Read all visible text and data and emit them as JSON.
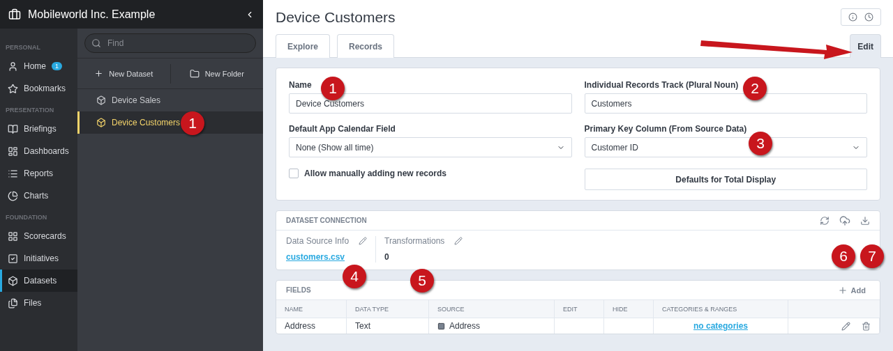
{
  "org": {
    "title": "Mobileworld Inc. Example"
  },
  "nav": [
    {
      "heading": "PERSONAL",
      "items": [
        {
          "label": "Home",
          "badge": "1",
          "selected": false
        },
        {
          "label": "Bookmarks",
          "selected": false
        }
      ]
    },
    {
      "heading": "PRESENTATION",
      "items": [
        {
          "label": "Briefings",
          "selected": false
        },
        {
          "label": "Dashboards",
          "selected": false
        },
        {
          "label": "Reports",
          "selected": false
        },
        {
          "label": "Charts",
          "selected": false
        }
      ]
    },
    {
      "heading": "FOUNDATION",
      "items": [
        {
          "label": "Scorecards",
          "selected": false
        },
        {
          "label": "Initiatives",
          "selected": false
        },
        {
          "label": "Datasets",
          "selected": true
        },
        {
          "label": "Files",
          "selected": false
        }
      ]
    }
  ],
  "browser": {
    "search_placeholder": "Find",
    "actions": [
      "New Dataset",
      "New Folder"
    ],
    "items": [
      {
        "label": "Device Sales",
        "selected": false
      },
      {
        "label": "Device Customers",
        "selected": true
      }
    ]
  },
  "page": {
    "title": "Device Customers",
    "tabs": [
      {
        "label": "Explore",
        "selected": false
      },
      {
        "label": "Records",
        "selected": false
      },
      {
        "label": "Edit",
        "selected": true
      }
    ]
  },
  "settings": {
    "name_label": "Name",
    "name_value": "Device Customers",
    "records_label": "Individual Records Track (Plural Noun)",
    "records_value": "Customers",
    "calendar_label": "Default App Calendar Field",
    "calendar_value": "None (Show all time)",
    "key_label": "Primary Key Column (From Source Data)",
    "key_value": "Customer ID",
    "allow_label": "Allow manually adding new records",
    "allow_checked": false,
    "defaults_button": "Defaults for Total Display"
  },
  "connection": {
    "title": "DATASET CONNECTION",
    "source_label": "Data Source Info",
    "source_value": "customers.csv",
    "transform_label": "Transformations",
    "transform_value": "0"
  },
  "fields": {
    "title": "FIELDS",
    "add": "Add",
    "columns": [
      "NAME",
      "DATA TYPE",
      "SOURCE",
      "EDIT",
      "HIDE",
      "CATEGORIES & RANGES"
    ],
    "rows": [
      {
        "name": "Address",
        "type": "Text",
        "source": "Address",
        "categories": "no categories"
      }
    ]
  },
  "callouts": [
    "1",
    "2",
    "3",
    "1",
    "4",
    "5",
    "6",
    "7"
  ]
}
